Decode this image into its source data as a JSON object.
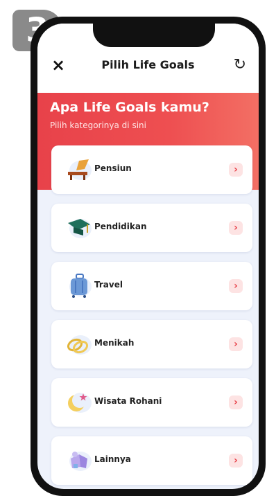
{
  "step_badge": "3",
  "header": {
    "close_icon": "×",
    "title": "Pilih Life Goals",
    "refresh_icon": "↻"
  },
  "hero": {
    "title": "Apa Life Goals kamu?",
    "subtitle": "Pilih kategorinya di sini",
    "color": "#e8424a"
  },
  "goals": [
    {
      "label": "Pensiun",
      "icon": "lounge-chair-icon"
    },
    {
      "label": "Pendidikan",
      "icon": "graduation-cap-icon"
    },
    {
      "label": "Travel",
      "icon": "suitcase-icon"
    },
    {
      "label": "Menikah",
      "icon": "wedding-rings-icon"
    },
    {
      "label": "Wisata Rohani",
      "icon": "crescent-moon-icon"
    },
    {
      "label": "Lainnya",
      "icon": "other-goals-icon"
    }
  ],
  "chevron": "›"
}
